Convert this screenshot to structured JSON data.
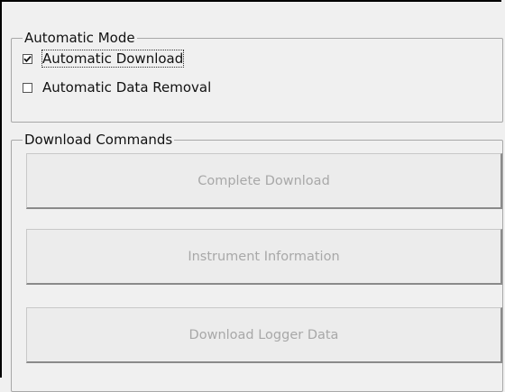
{
  "automatic_mode": {
    "title": "Automatic Mode",
    "options": [
      {
        "label": "Automatic Download",
        "checked": true
      },
      {
        "label": "Automatic Data Removal",
        "checked": false
      }
    ]
  },
  "download_commands": {
    "title": "Download Commands",
    "buttons": [
      {
        "label": "Complete Download",
        "enabled": false
      },
      {
        "label": "Instrument Information",
        "enabled": false
      },
      {
        "label": "Download Logger Data",
        "enabled": false
      }
    ]
  }
}
